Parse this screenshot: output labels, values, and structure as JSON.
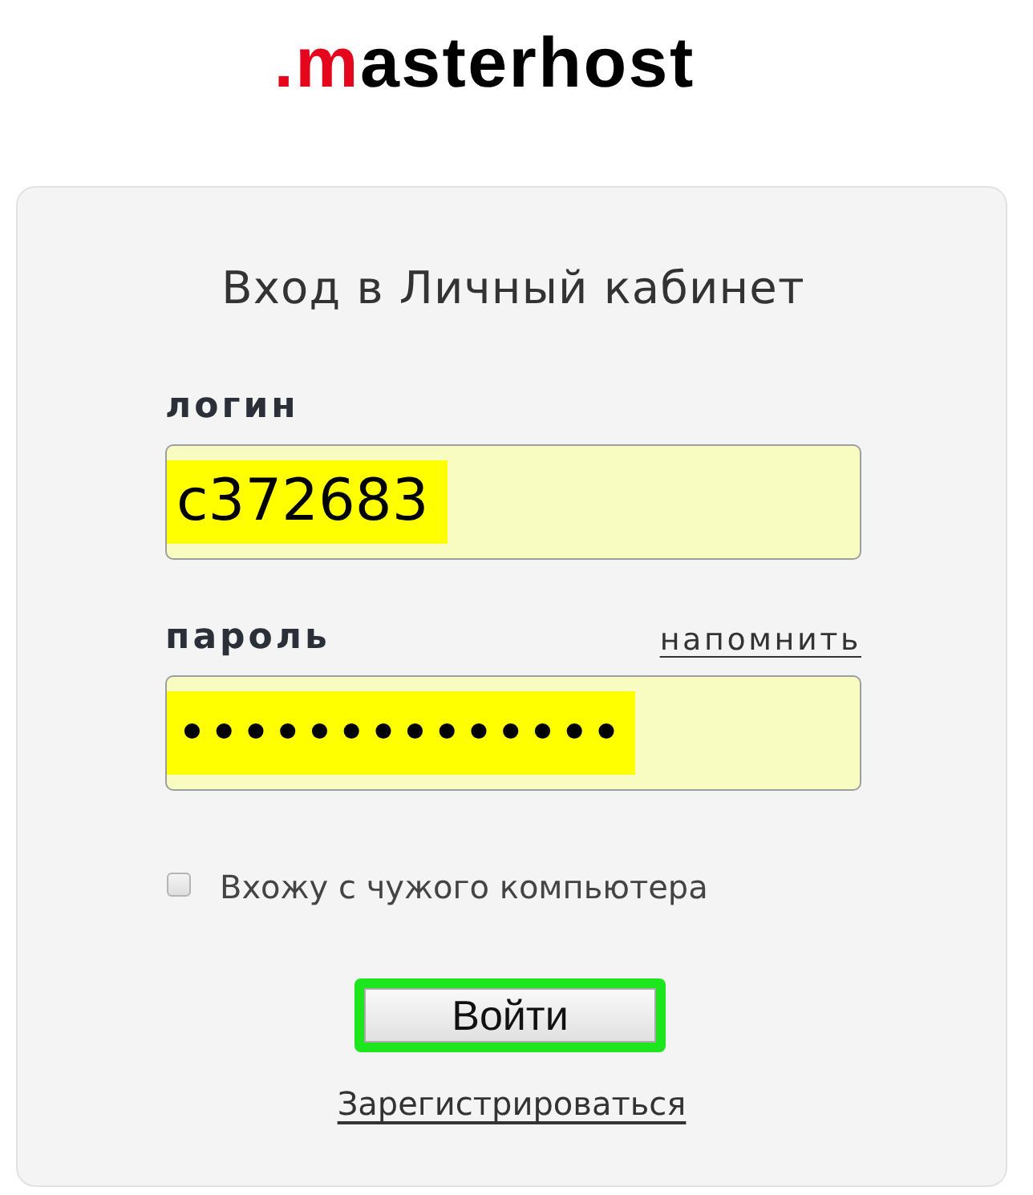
{
  "logo": {
    "accent": ".m",
    "rest": "asterhost"
  },
  "form": {
    "title": "Вход в Личный кабинет",
    "fields": [
      {
        "label": "логин",
        "value": "c372683",
        "highlighted": true
      },
      {
        "label": "пароль",
        "link": "напомнить",
        "value": "••••••••••••••",
        "highlighted": true
      }
    ],
    "remember": {
      "label": "Вхожу с чужого компьютера",
      "checked": false
    },
    "button": {
      "label": "Войти",
      "highlighted": true
    },
    "register_link": "Зарегистрироваться"
  }
}
